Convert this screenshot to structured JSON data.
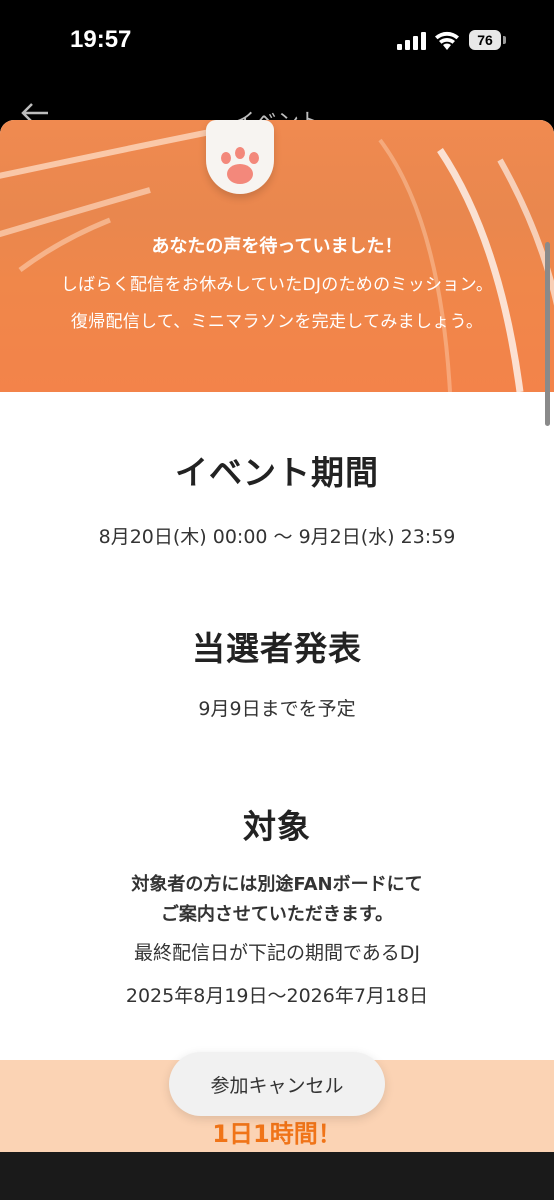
{
  "status_bar": {
    "time": "19:57",
    "battery": "76",
    "icons": [
      "signal-icon",
      "wifi-icon",
      "battery-icon"
    ]
  },
  "nav": {
    "title": "イベント",
    "back_icon": "back-arrow-icon"
  },
  "hero": {
    "headline": "あなたの声を待っていました！",
    "lines": [
      "しばらく配信をお休みしていたDJのためのミッション。",
      "復帰配信して、ミニマラソンを完走してみましょう。"
    ]
  },
  "sections": {
    "period": {
      "title": "イベント期間",
      "body": "8月20日(木) 00:00 〜 9月2日(水) 23:59"
    },
    "winners": {
      "title": "当選者発表",
      "body": "9月9日までを予定"
    },
    "target": {
      "title": "対象",
      "bold_lines": [
        "対象者の方には別途FANボードにて",
        "ご案内させていただきます。"
      ],
      "lines": [
        "最終配信日が下記の期間であるDJ",
        "2025年8月19日〜2026年7月18日"
      ]
    }
  },
  "banner": {
    "text": "1日1時間！"
  },
  "cancel_button": {
    "label": "参加キャンセル"
  },
  "colors": {
    "hero_orange": "#f0874a",
    "banner_bg": "#fbd3b4",
    "banner_text": "#f07418"
  }
}
